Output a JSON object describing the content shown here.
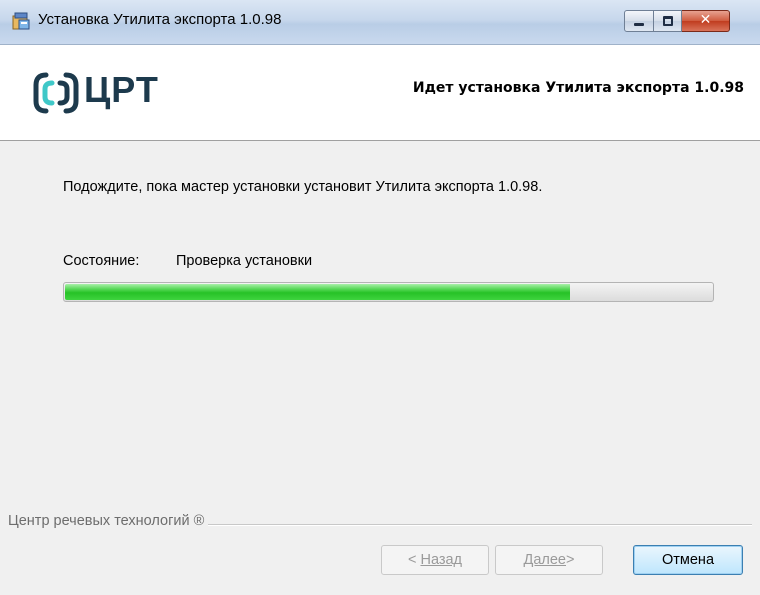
{
  "window": {
    "title": "Установка Утилита экспорта 1.0.98",
    "icon": "installer-icon",
    "controls": {
      "minimize": "minimize-icon",
      "maximize": "maximize-icon",
      "close": "✕"
    }
  },
  "header": {
    "logo_text": "ЦРТ",
    "title": "Идет установка Утилита экспорта 1.0.98"
  },
  "body": {
    "waiting_text": "Подождите, пока мастер установки установит Утилита экспорта 1.0.98.",
    "status_label": "Состояние:",
    "status_value": "Проверка установки",
    "progress_fraction": 0.78
  },
  "footer": {
    "company": "Центр речевых технологий ®",
    "back_prefix": "< ",
    "back_label": "Назад",
    "next_label": "Далее",
    "next_suffix": " >",
    "cancel_label": "Отмена"
  },
  "colors": {
    "progress_fill": "#27c227",
    "logo": "#1d3a4d",
    "header_bg": "#ffffff",
    "dialog_bg": "#f0f0f0"
  }
}
